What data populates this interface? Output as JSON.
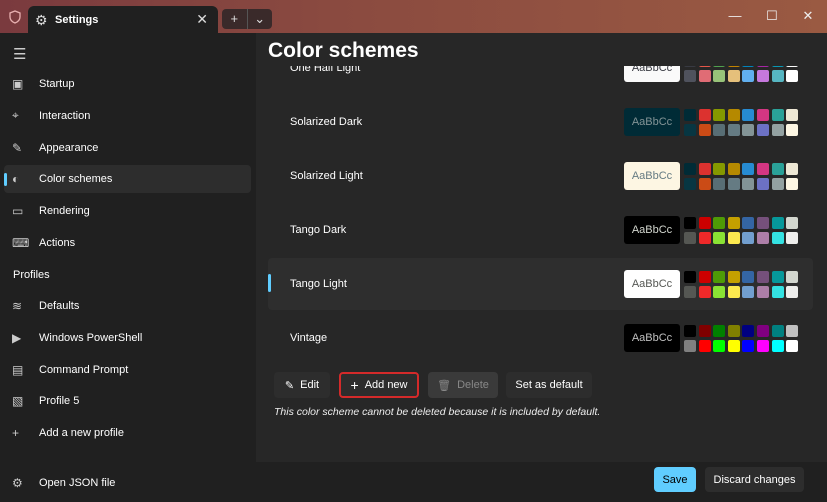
{
  "titlebar": {
    "tab_title": "Settings",
    "new_tab": "+",
    "dropdown": "⌄",
    "minimize": "—",
    "maximize": "☐",
    "close": "✕",
    "tab_close": "✕"
  },
  "sidebar": {
    "items": [
      {
        "label": "Startup",
        "icon": "▣"
      },
      {
        "label": "Interaction",
        "icon": "⌖"
      },
      {
        "label": "Appearance",
        "icon": "✎"
      },
      {
        "label": "Color schemes",
        "icon": "◐",
        "selected": true
      },
      {
        "label": "Rendering",
        "icon": "▭"
      },
      {
        "label": "Actions",
        "icon": "⌨"
      }
    ],
    "profiles_header": "Profiles",
    "profiles": [
      {
        "label": "Defaults",
        "icon": "≋"
      },
      {
        "label": "Windows PowerShell",
        "icon": "▶"
      },
      {
        "label": "Command Prompt",
        "icon": "▤"
      },
      {
        "label": "Profile 5",
        "icon": "▧"
      },
      {
        "label": "Add a new profile",
        "icon": "+"
      }
    ],
    "open_json": {
      "label": "Open JSON file",
      "icon": "⚙"
    }
  },
  "main": {
    "title": "Color schemes",
    "preview_text": "AaBbCc",
    "schemes": [
      {
        "name": "One Half Light",
        "bg": "#fafafa",
        "fg": "#383a42",
        "colors": [
          "#383a42",
          "#e45649",
          "#50a14f",
          "#c18301",
          "#0184bc",
          "#a626a4",
          "#0997b3",
          "#fafafa",
          "#4f525d",
          "#e06c75",
          "#98c379",
          "#e5c07b",
          "#61afef",
          "#c678dd",
          "#56b6c2",
          "#ffffff"
        ]
      },
      {
        "name": "Solarized Dark",
        "bg": "#002b36",
        "fg": "#839496",
        "colors": [
          "#002b36",
          "#dc322f",
          "#859900",
          "#b58900",
          "#268bd2",
          "#d33682",
          "#2aa198",
          "#eee8d5",
          "#073642",
          "#cb4b16",
          "#586e75",
          "#657b83",
          "#839496",
          "#6c71c4",
          "#93a1a1",
          "#fdf6e3"
        ]
      },
      {
        "name": "Solarized Light",
        "bg": "#fdf6e3",
        "fg": "#657b83",
        "colors": [
          "#002b36",
          "#dc322f",
          "#859900",
          "#b58900",
          "#268bd2",
          "#d33682",
          "#2aa198",
          "#eee8d5",
          "#073642",
          "#cb4b16",
          "#586e75",
          "#657b83",
          "#839496",
          "#6c71c4",
          "#93a1a1",
          "#fdf6e3"
        ]
      },
      {
        "name": "Tango Dark",
        "bg": "#000000",
        "fg": "#d3d7cf",
        "colors": [
          "#000000",
          "#cc0000",
          "#4e9a06",
          "#c4a000",
          "#3465a4",
          "#75507b",
          "#06989a",
          "#d3d7cf",
          "#555753",
          "#ef2929",
          "#8ae234",
          "#fce94f",
          "#729fcf",
          "#ad7fa8",
          "#34e2e2",
          "#eeeeec"
        ]
      },
      {
        "name": "Tango Light",
        "bg": "#ffffff",
        "fg": "#555753",
        "selected": true,
        "colors": [
          "#000000",
          "#cc0000",
          "#4e9a06",
          "#c4a000",
          "#3465a4",
          "#75507b",
          "#06989a",
          "#d3d7cf",
          "#555753",
          "#ef2929",
          "#8ae234",
          "#fce94f",
          "#729fcf",
          "#ad7fa8",
          "#34e2e2",
          "#eeeeec"
        ]
      },
      {
        "name": "Vintage",
        "bg": "#000000",
        "fg": "#c0c0c0",
        "colors": [
          "#000000",
          "#800000",
          "#008000",
          "#808000",
          "#000080",
          "#800080",
          "#008080",
          "#c0c0c0",
          "#808080",
          "#ff0000",
          "#00ff00",
          "#ffff00",
          "#0000ff",
          "#ff00ff",
          "#00ffff",
          "#ffffff"
        ]
      }
    ],
    "buttons": {
      "edit": "Edit",
      "add_new": "Add new",
      "delete": "Delete",
      "set_default": "Set as default"
    },
    "note": "This color scheme cannot be deleted because it is included by default."
  },
  "footer": {
    "save": "Save",
    "discard": "Discard changes"
  },
  "colors": {
    "accent": "#60cdff",
    "highlight_border": "#d42a2a"
  }
}
